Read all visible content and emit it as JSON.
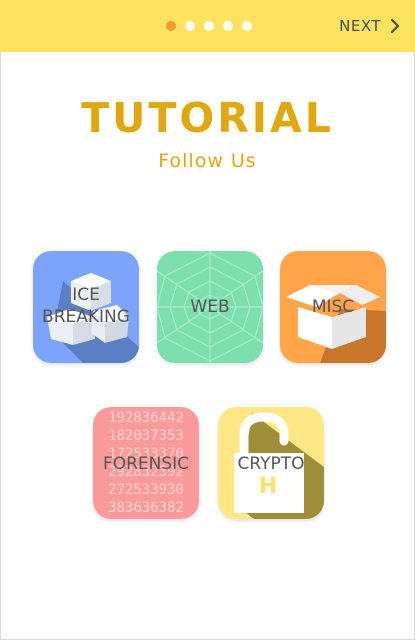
{
  "header": {
    "pager_dots": 5,
    "active_dot": 0,
    "next_label": "NEXT"
  },
  "hero": {
    "title": "TUTORIAL",
    "subtitle": "Follow Us"
  },
  "categories": [
    {
      "label_line1": "ICE",
      "label_line2": "BREAKING",
      "color": "#7ba4fa",
      "icon": "ice-cubes-icon"
    },
    {
      "label": "WEB",
      "color": "#7ddfae",
      "icon": "spider-web-icon"
    },
    {
      "label": "MISC",
      "color": "#fea54a",
      "icon": "open-box-icon"
    },
    {
      "label": "FORENSIC",
      "color": "#fb9a9a",
      "icon": "numbers-icon",
      "digits": [
        "192836442",
        "182037353",
        "172533370",
        "292832392",
        "272533930",
        "383636382"
      ]
    },
    {
      "label": "CRYPTO",
      "color": "#fee784",
      "icon": "padlock-icon",
      "lock_letter": "H"
    }
  ],
  "colors": {
    "header_bg": "#fbe35f",
    "accent": "#e0a80f",
    "active_dot": "#f39a2c"
  }
}
